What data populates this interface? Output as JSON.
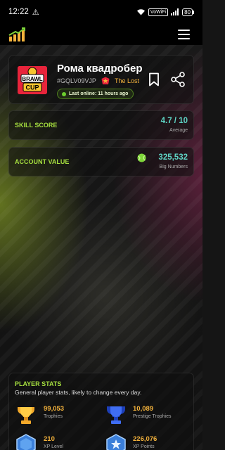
{
  "status_bar": {
    "time": "12:22",
    "warning_icon": "warning-icon",
    "network_badge": "VoWiFi",
    "battery": "80"
  },
  "header": {
    "logo_icon": "bar-chart-logo-icon",
    "menu_icon": "hamburger-menu-icon"
  },
  "profile": {
    "name": "Рома квадробер",
    "tag": "#GQLV09VJP",
    "club_name": "The Lost",
    "last_online": "Last online: 11 hours ago",
    "avatar_icon": "brawl-cup-avatar"
  },
  "skill_score": {
    "label": "SKILL SCORE",
    "value": "4.7 / 10",
    "sub": "Average"
  },
  "account_value": {
    "label": "ACCOUNT VALUE",
    "value": "325,532",
    "sub": "Big Numbers",
    "icon": "gem-ball-icon"
  },
  "player_stats": {
    "title": "PLAYER STATS",
    "description": "General player stats, likely to change every day.",
    "items": [
      {
        "value": "99,053",
        "label": "Trophies",
        "icon": "trophy-icon"
      },
      {
        "value": "10,089",
        "label": "Prestige Trophies",
        "icon": "prestige-trophy-icon"
      },
      {
        "value": "210",
        "label": "XP Level",
        "icon": "xp-level-icon"
      },
      {
        "value": "226,076",
        "label": "XP Points",
        "icon": "xp-points-icon"
      }
    ]
  },
  "colors": {
    "accent_green": "#a6df3f",
    "accent_teal": "#5fd6c6",
    "accent_gold": "#f3b23c"
  }
}
